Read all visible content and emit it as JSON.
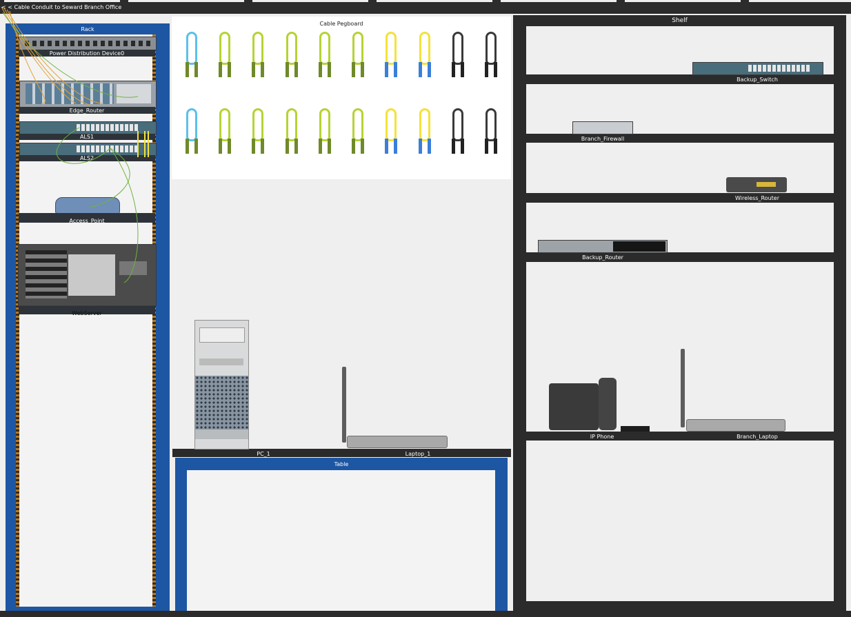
{
  "nav": {
    "back_link": "< < Cable Conduit to Seward Branch Office"
  },
  "rack": {
    "title": "Rack",
    "devices": {
      "pdu": "Power Distribution Device0",
      "edge_router": "Edge_Router",
      "als1": "ALS1",
      "als2": "ALS2",
      "access_point": "Access_Point",
      "webserver": "WebServer"
    }
  },
  "pegboard": {
    "title": "Cable Pegboard",
    "cable_rows": [
      [
        "#5bc0eb",
        "#b5d334",
        "#b5d334",
        "#b5d334",
        "#b5d334",
        "#b5d334",
        "#f3e23a",
        "#f3e23a",
        "#3a3a3a",
        "#3a3a3a"
      ],
      [
        "#5bc0eb",
        "#b5d334",
        "#b5d334",
        "#b5d334",
        "#b5d334",
        "#b5d334",
        "#f3e23a",
        "#f3e23a",
        "#3a3a3a",
        "#3a3a3a"
      ]
    ]
  },
  "table": {
    "title": "Table",
    "devices": {
      "pc": "PC_1",
      "laptop": "Laptop_1"
    }
  },
  "shelf": {
    "title": "Shelf",
    "devices": {
      "backup_switch": "Backup_Switch",
      "branch_firewall": "Branch_Firewall",
      "wireless_router": "Wireless_Router",
      "backup_router": "Backup_Router",
      "ip_phone": "IP Phone",
      "branch_laptop": "Branch_Laptop"
    }
  },
  "colors": {
    "rack_blue": "#1d56a3",
    "shelf_dark": "#2b2b2b",
    "cable_green": "#6fb33f",
    "cable_orange": "#e2a23a"
  }
}
